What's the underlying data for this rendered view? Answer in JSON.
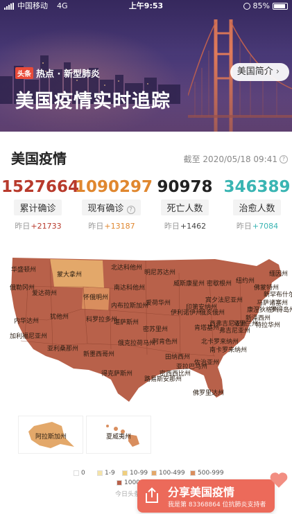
{
  "status_bar": {
    "carrier": "中国移动",
    "network": "4G",
    "time": "上午9:53",
    "battery": "85%"
  },
  "banner": {
    "badge": "头条",
    "topic": "热点 · 新型肺炎",
    "title": "美国疫情实时追踪",
    "intro_button": "美国简介"
  },
  "section": {
    "title": "美国疫情",
    "updated": "截至 2020/05/18 09:41"
  },
  "stats": [
    {
      "value": "1527664",
      "label": "累计确诊",
      "delta_prefix": "昨日",
      "delta": "+21733",
      "color": "#b83a2c",
      "delta_color": "#b83a2c",
      "has_help": false
    },
    {
      "value": "1090297",
      "label": "现有确诊",
      "delta_prefix": "昨日",
      "delta": "+13187",
      "color": "#e0872f",
      "delta_color": "#e0872f",
      "has_help": true
    },
    {
      "value": "90978",
      "label": "死亡人数",
      "delta_prefix": "昨日",
      "delta": "+1462",
      "color": "#222222",
      "delta_color": "#444444",
      "has_help": false
    },
    {
      "value": "346389",
      "label": "治愈人数",
      "delta_prefix": "昨日",
      "delta": "+7084",
      "color": "#3ab5b3",
      "delta_color": "#3ab5b3",
      "has_help": false
    }
  ],
  "map": {
    "colors": {
      "c1000plus": "#b8614a",
      "c500_999": "#d98e5e",
      "c100_499": "#e3a86a",
      "c10_99": "#f0cf7e",
      "c1_9": "#f5e3a8",
      "c0": "#ffffff"
    },
    "state_labels": [
      "华盛顿州",
      "蒙大拿州",
      "北达科他州",
      "明尼苏达州",
      "俄勒冈州",
      "爱达荷州",
      "南达科他州",
      "怀俄明州",
      "威斯康星州",
      "密歇根州",
      "内布拉斯加州",
      "爱荷华州",
      "伊利诺伊州",
      "印第安纳州",
      "俄亥俄州",
      "宾夕法尼亚州",
      "纽约州",
      "内华达州",
      "犹他州",
      "科罗拉多州",
      "堪萨斯州",
      "密苏里州",
      "肯塔基州",
      "西弗吉尼亚州",
      "弗吉尼亚州",
      "加利福尼亚州",
      "亚利桑那州",
      "新墨西哥州",
      "俄克拉荷马州",
      "阿肯色州",
      "田纳西州",
      "北卡罗来纳州",
      "南卡罗来纳州",
      "密西西比州",
      "亚拉巴马州",
      "佐治亚州",
      "路易斯安那州",
      "得克萨斯州",
      "佛罗里达州",
      "缅因州",
      "佛蒙特州",
      "新罕布什尔州",
      "马萨诸塞州",
      "罗得岛州",
      "康涅狄格州",
      "新泽西州",
      "特拉华州",
      "马里兰州"
    ],
    "inset_alaska": "阿拉斯加州",
    "inset_hawaii": "夏威夷州"
  },
  "legend": [
    {
      "label": "0",
      "color": "#ffffff"
    },
    {
      "label": "1-9",
      "color": "#f5e3a8"
    },
    {
      "label": "10-99",
      "color": "#f0cf7e"
    },
    {
      "label": "100-499",
      "color": "#e3a86a"
    },
    {
      "label": "500-999",
      "color": "#d98e5e"
    },
    {
      "label": "1000-9",
      "color": "#b8614a"
    }
  ],
  "source_text": "今日头条",
  "share": {
    "title": "分享美国疫情",
    "subtitle": "我是第 83368864 位抗肺炎支持者"
  }
}
